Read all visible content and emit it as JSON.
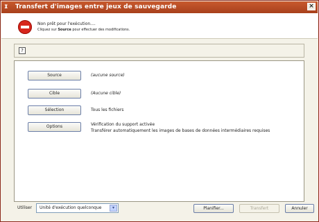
{
  "window": {
    "title": "Transfert d'images entre jeux de sauvegarde",
    "icon": "app-icon",
    "close_label": "×"
  },
  "status": {
    "title": "Non prêt pour l'exécution....",
    "hint_prefix": "Cliquez sur ",
    "hint_bold": "Source",
    "hint_suffix": " pour effectuer des modifications."
  },
  "help": {
    "icon": "help-icon",
    "label": "?"
  },
  "rows": {
    "source": {
      "button": "Source",
      "value": "(aucune source)"
    },
    "cible": {
      "button": "Cible",
      "value": "(Aucune cible)"
    },
    "selection": {
      "button": "Sélection",
      "value": "Tous les fichiers"
    },
    "options": {
      "button": "Options",
      "value_line1": "Vérification du support activée",
      "value_line2": "Transférer automatiquement les images de bases de données intermédiaires requises"
    }
  },
  "footer": {
    "use_label": "Utiliser",
    "device_value": "Unité d'exécution quelconque",
    "planifier": "Planifier...",
    "transfert": "Transfert",
    "annuler": "Annuler"
  },
  "colors": {
    "titlebar": "#b04a22",
    "stop": "#d7261c"
  }
}
